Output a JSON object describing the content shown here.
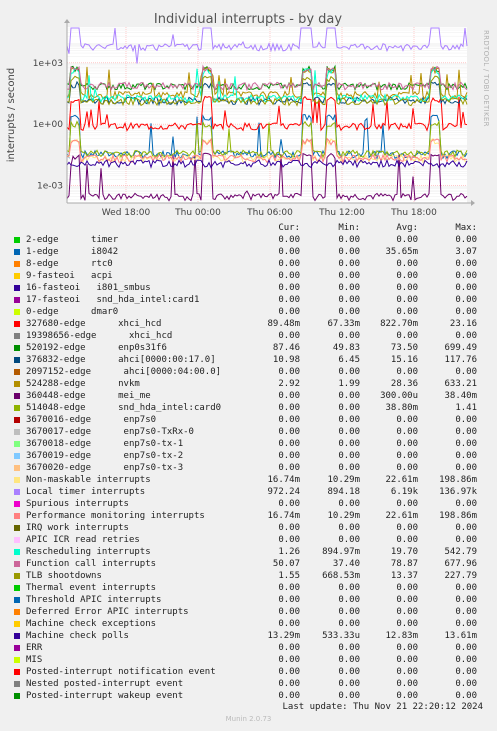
{
  "chart_data": {
    "type": "line",
    "title": "Individual interrupts - by day",
    "ylabel": "interrupts / second",
    "yscale": "log",
    "yticks": [
      "1e+03",
      "1e+00",
      "1e-03"
    ],
    "xticks": [
      "Wed 18:00",
      "Thu 00:00",
      "Thu 06:00",
      "Thu 12:00",
      "Thu 18:00"
    ],
    "grid": true,
    "legend_placement": "below",
    "columns": [
      "Cur:",
      "Min:",
      "Avg:",
      "Max:"
    ],
    "series": [
      {
        "name": "2-edge      timer",
        "color": "#00cc00",
        "cur": "0.00",
        "min": "0.00",
        "avg": "0.00",
        "max": "0.00"
      },
      {
        "name": "1-edge      i8042",
        "color": "#0066b3",
        "cur": "0.00",
        "min": "0.00",
        "avg": "35.65m",
        "max": "3.07"
      },
      {
        "name": "8-edge      rtc0",
        "color": "#ff8000",
        "cur": "0.00",
        "min": "0.00",
        "avg": "0.00",
        "max": "0.00"
      },
      {
        "name": "9-fasteoi   acpi",
        "color": "#ffcc00",
        "cur": "0.00",
        "min": "0.00",
        "avg": "0.00",
        "max": "0.00"
      },
      {
        "name": "16-fasteoi   i801_smbus",
        "color": "#330099",
        "cur": "0.00",
        "min": "0.00",
        "avg": "0.00",
        "max": "0.00"
      },
      {
        "name": "17-fasteoi   snd_hda_intel:card1",
        "color": "#990099",
        "cur": "0.00",
        "min": "0.00",
        "avg": "0.00",
        "max": "0.00"
      },
      {
        "name": "0-edge      dmar0",
        "color": "#ccff00",
        "cur": "0.00",
        "min": "0.00",
        "avg": "0.00",
        "max": "0.00"
      },
      {
        "name": "327680-edge      xhci_hcd",
        "color": "#ff0000",
        "cur": "89.48m",
        "min": "67.33m",
        "avg": "822.70m",
        "max": "23.16"
      },
      {
        "name": "19398656-edge      xhci_hcd",
        "color": "#808080",
        "cur": "0.00",
        "min": "0.00",
        "avg": "0.00",
        "max": "0.00"
      },
      {
        "name": "520192-edge      enp0s31f6",
        "color": "#008f00",
        "cur": "87.46",
        "min": "49.83",
        "avg": "73.50",
        "max": "699.49"
      },
      {
        "name": "376832-edge      ahci[0000:00:17.0]",
        "color": "#00487d",
        "cur": "10.98",
        "min": "6.45",
        "avg": "15.16",
        "max": "117.76"
      },
      {
        "name": "2097152-edge      ahci[0000:04:00.0]",
        "color": "#b35a00",
        "cur": "0.00",
        "min": "0.00",
        "avg": "0.00",
        "max": "0.00"
      },
      {
        "name": "524288-edge      nvkm",
        "color": "#b38f00",
        "cur": "2.92",
        "min": "1.99",
        "avg": "28.36",
        "max": "633.21"
      },
      {
        "name": "360448-edge      mei_me",
        "color": "#6b006b",
        "cur": "0.00",
        "min": "0.00",
        "avg": "300.00u",
        "max": "38.40m"
      },
      {
        "name": "514048-edge      snd_hda_intel:card0",
        "color": "#8fb300",
        "cur": "0.00",
        "min": "0.00",
        "avg": "38.80m",
        "max": "1.41"
      },
      {
        "name": "3670016-edge      enp7s0",
        "color": "#b30000",
        "cur": "0.00",
        "min": "0.00",
        "avg": "0.00",
        "max": "0.00"
      },
      {
        "name": "3670017-edge      enp7s0-TxRx-0",
        "color": "#bebebe",
        "cur": "0.00",
        "min": "0.00",
        "avg": "0.00",
        "max": "0.00"
      },
      {
        "name": "3670018-edge      enp7s0-tx-1",
        "color": "#80ff80",
        "cur": "0.00",
        "min": "0.00",
        "avg": "0.00",
        "max": "0.00"
      },
      {
        "name": "3670019-edge      enp7s0-tx-2",
        "color": "#80c9ff",
        "cur": "0.00",
        "min": "0.00",
        "avg": "0.00",
        "max": "0.00"
      },
      {
        "name": "3670020-edge      enp7s0-tx-3",
        "color": "#ffc080",
        "cur": "0.00",
        "min": "0.00",
        "avg": "0.00",
        "max": "0.00"
      },
      {
        "name": "Non-maskable interrupts",
        "color": "#ffe680",
        "cur": "16.74m",
        "min": "10.29m",
        "avg": "22.61m",
        "max": "198.86m"
      },
      {
        "name": "Local timer interrupts",
        "color": "#aa80ff",
        "cur": "972.24",
        "min": "894.18",
        "avg": "6.19k",
        "max": "136.97k"
      },
      {
        "name": "Spurious interrupts",
        "color": "#ee00cc",
        "cur": "0.00",
        "min": "0.00",
        "avg": "0.00",
        "max": "0.00"
      },
      {
        "name": "Performance monitoring interrupts",
        "color": "#ff8080",
        "cur": "16.74m",
        "min": "10.29m",
        "avg": "22.61m",
        "max": "198.86m"
      },
      {
        "name": "IRQ work interrupts",
        "color": "#666600",
        "cur": "0.00",
        "min": "0.00",
        "avg": "0.00",
        "max": "0.00"
      },
      {
        "name": "APIC ICR read retries",
        "color": "#ffbfff",
        "cur": "0.00",
        "min": "0.00",
        "avg": "0.00",
        "max": "0.00"
      },
      {
        "name": "Rescheduling interrupts",
        "color": "#00ffcc",
        "cur": "1.26",
        "min": "894.97m",
        "avg": "19.70",
        "max": "542.79"
      },
      {
        "name": "Function call interrupts",
        "color": "#cc6699",
        "cur": "50.07",
        "min": "37.40",
        "avg": "78.87",
        "max": "677.96"
      },
      {
        "name": "TLB shootdowns",
        "color": "#999900",
        "cur": "1.55",
        "min": "668.53m",
        "avg": "13.37",
        "max": "227.79"
      },
      {
        "name": "Thermal event interrupts",
        "color": "#00cc00",
        "cur": "0.00",
        "min": "0.00",
        "avg": "0.00",
        "max": "0.00"
      },
      {
        "name": "Threshold APIC interrupts",
        "color": "#0066b3",
        "cur": "0.00",
        "min": "0.00",
        "avg": "0.00",
        "max": "0.00"
      },
      {
        "name": "Deferred Error APIC interrupts",
        "color": "#ff8000",
        "cur": "0.00",
        "min": "0.00",
        "avg": "0.00",
        "max": "0.00"
      },
      {
        "name": "Machine check exceptions",
        "color": "#ffcc00",
        "cur": "0.00",
        "min": "0.00",
        "avg": "0.00",
        "max": "0.00"
      },
      {
        "name": "Machine check polls",
        "color": "#330099",
        "cur": "13.29m",
        "min": "533.33u",
        "avg": "12.83m",
        "max": "13.61m"
      },
      {
        "name": "ERR",
        "color": "#990099",
        "cur": "0.00",
        "min": "0.00",
        "avg": "0.00",
        "max": "0.00"
      },
      {
        "name": "MIS",
        "color": "#ccff00",
        "cur": "0.00",
        "min": "0.00",
        "avg": "0.00",
        "max": "0.00"
      },
      {
        "name": "Posted-interrupt notification event",
        "color": "#ff0000",
        "cur": "0.00",
        "min": "0.00",
        "avg": "0.00",
        "max": "0.00"
      },
      {
        "name": "Nested posted-interrupt event",
        "color": "#808080",
        "cur": "0.00",
        "min": "0.00",
        "avg": "0.00",
        "max": "0.00"
      },
      {
        "name": "Posted-interrupt wakeup event",
        "color": "#008f00",
        "cur": "0.00",
        "min": "0.00",
        "avg": "0.00",
        "max": "0.00"
      }
    ]
  },
  "last_update": "Last update: Thu Nov 21 22:20:12 2024",
  "footer": "Munin 2.0.73",
  "watermark": "RRDTOOL / TOBI OETIKER"
}
